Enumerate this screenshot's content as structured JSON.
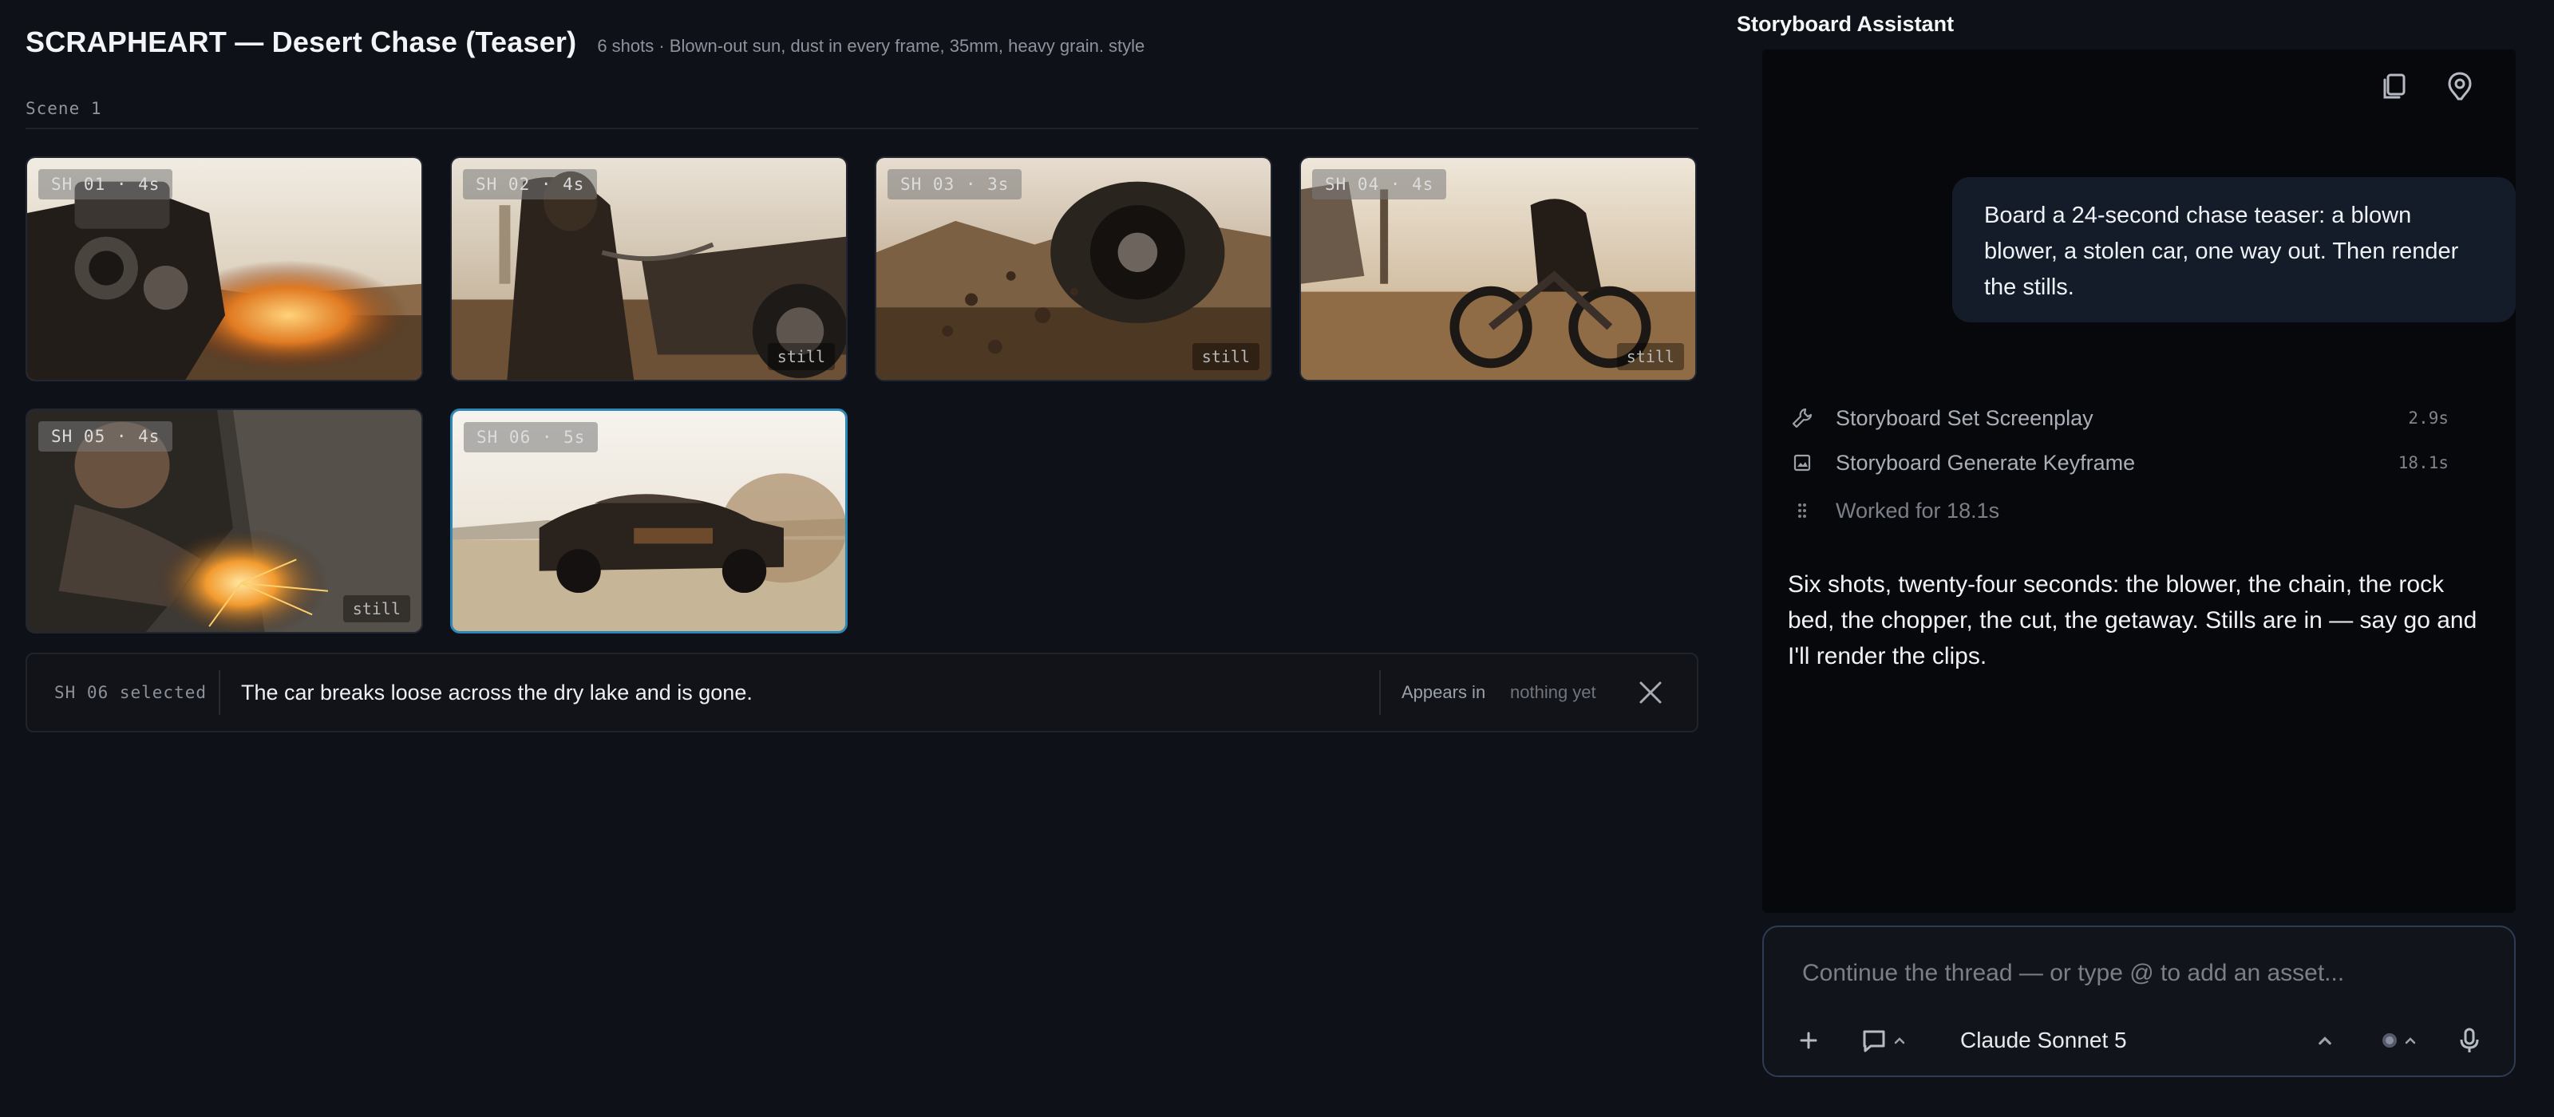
{
  "board": {
    "title": "SCRAPHEART — Desert Chase (Teaser)",
    "subtitle": "6 shots · Blown-out sun, dust in every frame, 35mm, heavy grain. style",
    "scene_label": "Scene 1",
    "shots": [
      {
        "badge": "SH 01 · 4s",
        "still": "",
        "image": "engine-explosion-photo"
      },
      {
        "badge": "SH 02 · 4s",
        "still": "still",
        "image": "chain-rider-photo"
      },
      {
        "badge": "SH 03 · 3s",
        "still": "still",
        "image": "rock-bed-wheel-photo"
      },
      {
        "badge": "SH 04 · 4s",
        "still": "still",
        "image": "chopper-rider-photo"
      },
      {
        "badge": "SH 05 · 4s",
        "still": "still",
        "image": "welding-sparks-photo"
      },
      {
        "badge": "SH 06 · 5s",
        "still": "",
        "image": "muscle-car-getaway-photo"
      }
    ],
    "selection": {
      "label": "SH 06 selected",
      "caption": "The car breaks loose across the dry lake and is gone.",
      "appears_label": "Appears in",
      "appears_value": "nothing yet"
    },
    "accent_selected": "#2c88b8"
  },
  "assistant": {
    "title": "Storyboard Assistant",
    "user_message": "Board a 24-second chase teaser: a blown blower, a stolen car, one way out. Then render the stills.",
    "tools": [
      {
        "label": "Storyboard Set Screenplay",
        "time": "2.9s",
        "icon": "wrench-icon"
      },
      {
        "label": "Storyboard Generate Keyframe",
        "time": "18.1s",
        "icon": "image-icon"
      }
    ],
    "worked": "Worked for 18.1s",
    "reply": "Six shots, twenty-four seconds: the blower, the chain, the rock bed, the chopper, the cut, the getaway. Stills are in — say go and I'll render the clips.",
    "composer": {
      "placeholder": "Continue the thread — or type @ to add an asset...",
      "model": "Claude Sonnet 5"
    }
  }
}
